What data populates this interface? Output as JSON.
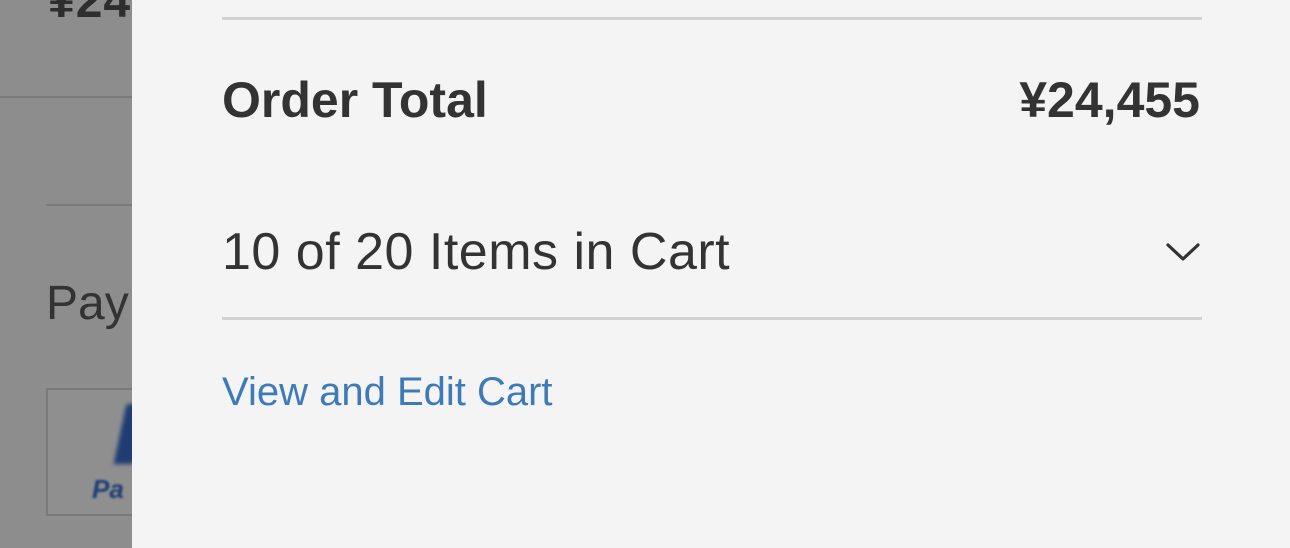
{
  "background_page": {
    "price_fragment": "¥24",
    "payment_heading_fragment": "Pay",
    "paypal_fragment": "Pa"
  },
  "minicart": {
    "order_total_label": "Order Total",
    "order_total_value": "¥24,455",
    "items_summary": "10 of 20 Items in Cart",
    "toggle_icon": "chevron-down-icon",
    "view_edit_link": "View and Edit Cart"
  },
  "colors": {
    "panel_background": "#f4f4f4",
    "overlay": "#8d8d8d",
    "text": "#333333",
    "link": "#3e7ab8",
    "divider": "#d2d2d2"
  }
}
